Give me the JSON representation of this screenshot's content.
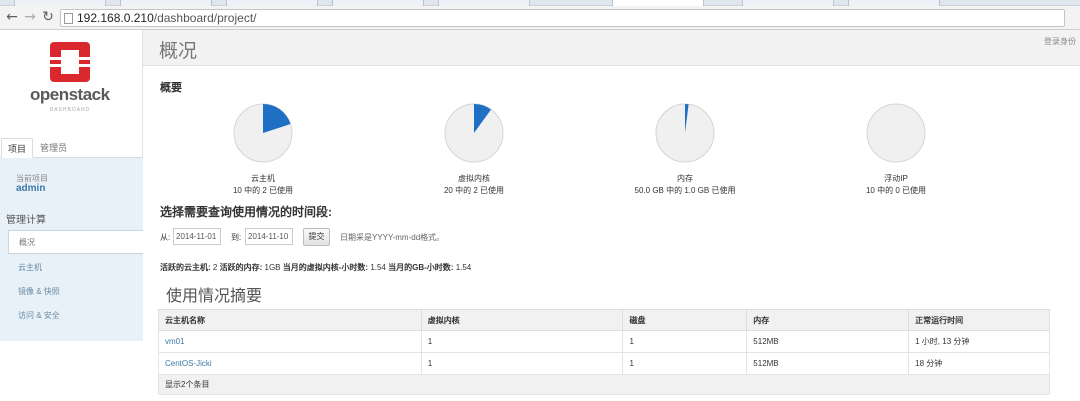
{
  "browser": {
    "url_host": "192.168.0.210",
    "url_path": "/dashboard/project/",
    "back_icon": "arrow-left-icon",
    "forward_icon": "arrow-right-icon",
    "reload_icon": "reload-icon"
  },
  "sidebar": {
    "brand": "openstack",
    "brand_sub": "DASHBOARD",
    "tabs": [
      {
        "label": "项目"
      },
      {
        "label": "管理员"
      }
    ],
    "current_project_label": "当前项目",
    "current_project": "admin",
    "section_title": "管理计算",
    "items": [
      {
        "label": "概况"
      },
      {
        "label": "云主机"
      },
      {
        "label": "镜像 & 快照"
      },
      {
        "label": "访问 & 安全"
      }
    ]
  },
  "header": {
    "title": "概况",
    "user_link": "登录身份"
  },
  "overview": {
    "title": "概要",
    "pies": [
      {
        "title": "云主机",
        "subtitle": "10 中的 2 已使用",
        "used_fraction": 0.2
      },
      {
        "title": "虚拟内核",
        "subtitle": "20 中的 2 已使用",
        "used_fraction": 0.1
      },
      {
        "title": "内存",
        "subtitle": "50.0 GB 中的 1.0 GB 已使用",
        "used_fraction": 0.02
      },
      {
        "title": "浮动IP",
        "subtitle": "10 中的 0 已使用",
        "used_fraction": 0
      }
    ]
  },
  "period": {
    "title": "选择需要查询使用情况的时间段:",
    "from_label": "从:",
    "from_value": "2014-11-01",
    "to_label": "到:",
    "to_value": "2014-11-10",
    "submit_label": "提交",
    "hint": "日期采是YYYY-mm-dd格式。"
  },
  "summary_line": {
    "vms_label": "活跃的云主机:",
    "vms_value": "2",
    "ram_label": "活跃的内存:",
    "ram_value": "1GB",
    "vcpu_label": "当月的虚拟内核-小时数:",
    "vcpu_value": "1.54",
    "gb_label": "当月的GB-小时数:",
    "gb_value": "1.54"
  },
  "usage": {
    "title": "使用情况摘要",
    "columns": [
      "云主机名称",
      "虚拟内核",
      "磁盘",
      "内存",
      "正常运行时间"
    ],
    "rows": [
      [
        "vm01",
        "1",
        "1",
        "512MB",
        "1 小时, 13 分钟"
      ],
      [
        "CentOS-Jicki",
        "1",
        "1",
        "512MB",
        "18 分钟"
      ]
    ],
    "footer": "显示2个条目"
  },
  "colors": {
    "pie_used": "#1f6fc5",
    "pie_free": "#f0f0f0",
    "pie_border": "#d5d5d5",
    "logo_red": "#d9292f",
    "link": "#3d7aa7"
  }
}
